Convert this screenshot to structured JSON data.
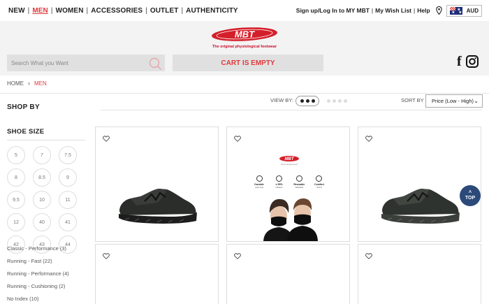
{
  "nav": {
    "items": [
      {
        "label": "NEW",
        "active": false
      },
      {
        "label": "MEN",
        "active": true
      },
      {
        "label": "WOMEN",
        "active": false
      },
      {
        "label": "ACCESSORIES",
        "active": false
      },
      {
        "label": "OUTLET",
        "active": false
      },
      {
        "label": "AUTHENTICITY",
        "active": false
      }
    ],
    "separator": "|"
  },
  "utility": {
    "signin": "Sign up/Log In to MY MBT",
    "wishlist": "My Wish List",
    "help": "Help",
    "country": "AUD"
  },
  "brand": {
    "logo": "MBT",
    "tagline": "The original physiological footwear",
    "accent_color": "#e03a3e"
  },
  "search": {
    "placeholder": "Search What you Want"
  },
  "cart": {
    "label": "CART IS EMPTY"
  },
  "breadcrumb": {
    "home": "HOME",
    "current": "MEN"
  },
  "sidebar": {
    "title": "SHOP BY",
    "shoe_size_label": "SHOE SIZE",
    "sizes": [
      "5",
      "7",
      "7.5",
      "8",
      "8.5",
      "9",
      "9.5",
      "10",
      "11",
      "12",
      "40",
      "41",
      "42",
      "43",
      "44"
    ],
    "categories": [
      "Classic - Performance (3)",
      "Running - Fast (22)",
      "Running - Performance (4)",
      "Running - Cushioning (2)",
      "No Index (10)"
    ]
  },
  "toolbar": {
    "view_by": "VIEW BY:",
    "sort_by": "SORT BY",
    "sort_value": "Price (Low - High)"
  },
  "promo": {
    "logo": "MBT",
    "tagline": "Swiss Engineered",
    "features": [
      {
        "title": "Durable",
        "sub": "Lasts long"
      },
      {
        "title": "≥ 95%",
        "sub": "Filtration"
      },
      {
        "title": "Reusable",
        "sub": "Washable"
      },
      {
        "title": "Comfort",
        "sub": "Soft fit"
      }
    ]
  },
  "top_button": {
    "label": "TOP"
  }
}
